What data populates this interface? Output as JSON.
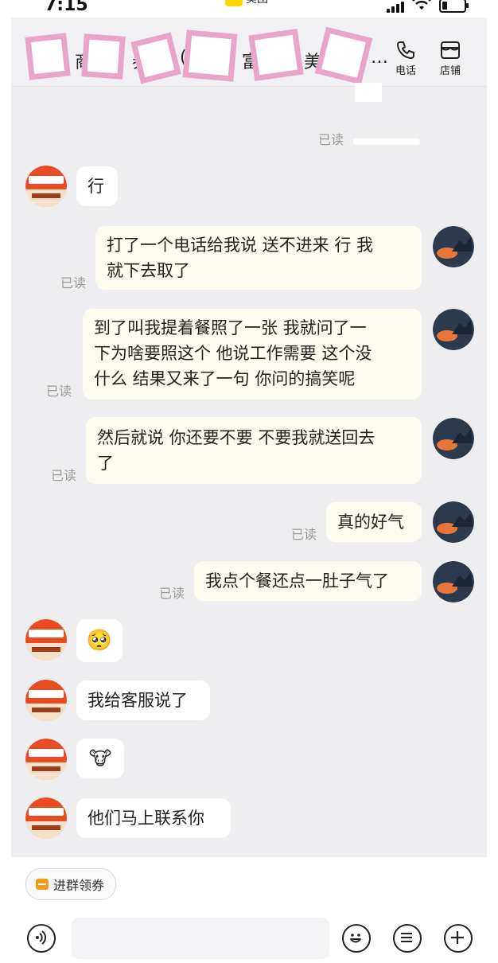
{
  "status_bar": {
    "time": "7:15",
    "center_app": "美团"
  },
  "header": {
    "title_fragments": [
      "商",
      "券",
      "(",
      "富",
      "美",
      "…"
    ],
    "phone_label": "电话",
    "shop_label": "店铺"
  },
  "messages": [
    {
      "from": "self",
      "text": "",
      "read_label": "已读"
    },
    {
      "from": "shop",
      "text": "行"
    },
    {
      "from": "self",
      "lines": [
        "打了一个电话给我说 送不进来  行  我",
        "就下去取了"
      ],
      "read_label": "已读"
    },
    {
      "from": "self",
      "lines": [
        "到了叫我提着餐照了一张  我就问了一",
        "下为啥要照这个  他说工作需要  这个没",
        "什么  结果又来了一句 你问的搞笑呢"
      ],
      "read_label": "已读"
    },
    {
      "from": "self",
      "lines": [
        "然后就说 你还要不要  不要我就送回去",
        "了"
      ],
      "read_label": "已读"
    },
    {
      "from": "self",
      "text": "真的好气",
      "read_label": "已读"
    },
    {
      "from": "self",
      "text": "我点个餐还点一肚子气了",
      "read_label": "已读"
    },
    {
      "from": "shop",
      "emoji": "🥺"
    },
    {
      "from": "shop",
      "text": "我给客服说了"
    },
    {
      "from": "shop",
      "emoji": "🐮"
    },
    {
      "from": "shop",
      "text": "他们马上联系你"
    }
  ],
  "bottom": {
    "coupon_label": "进群领券",
    "input_placeholder": "",
    "buttons": [
      "voice",
      "emoji",
      "more-menu",
      "add"
    ]
  },
  "colors": {
    "accent_yellow": "#ffd400",
    "shop_avatar_red": "#e74c23",
    "redaction_pink": "#e9a5c9"
  }
}
